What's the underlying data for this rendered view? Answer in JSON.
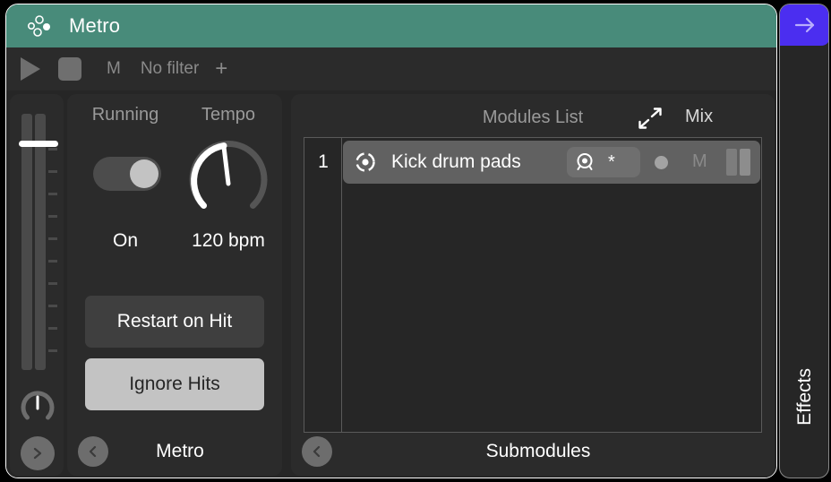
{
  "titlebar": {
    "icon": "dots-logo-icon",
    "title": "Metro"
  },
  "toolbar": {
    "play": "play-icon",
    "stop": "stop-icon",
    "m_label": "M",
    "filter_label": "No filter",
    "add_label": "+"
  },
  "mixer": {
    "fader": "volume-fader",
    "pan": "pan-knob",
    "nav": "›"
  },
  "metro_panel": {
    "running_label": "Running",
    "tempo_label": "Tempo",
    "running_value": "On",
    "tempo_value": "120 bpm",
    "restart_button": "Restart on Hit",
    "ignore_button": "Ignore Hits",
    "footer_back": "‹",
    "footer_title": "Metro"
  },
  "modules_panel": {
    "title": "Modules List",
    "mix_label": "Mix",
    "expand": "expand-icon",
    "footer_back": "‹",
    "footer_title": "Submodules",
    "rows": [
      {
        "number": "1",
        "name": "Kick drum pads",
        "star": "*",
        "mute": "M"
      }
    ]
  },
  "effects_rail": {
    "arrow": "→",
    "label": "Effects"
  },
  "colors": {
    "accent_teal": "#488b7a",
    "accent_purple": "#4b2ef0",
    "panel_bg": "#2b2b2b",
    "window_bg": "#262626",
    "row_bg": "#616161"
  }
}
